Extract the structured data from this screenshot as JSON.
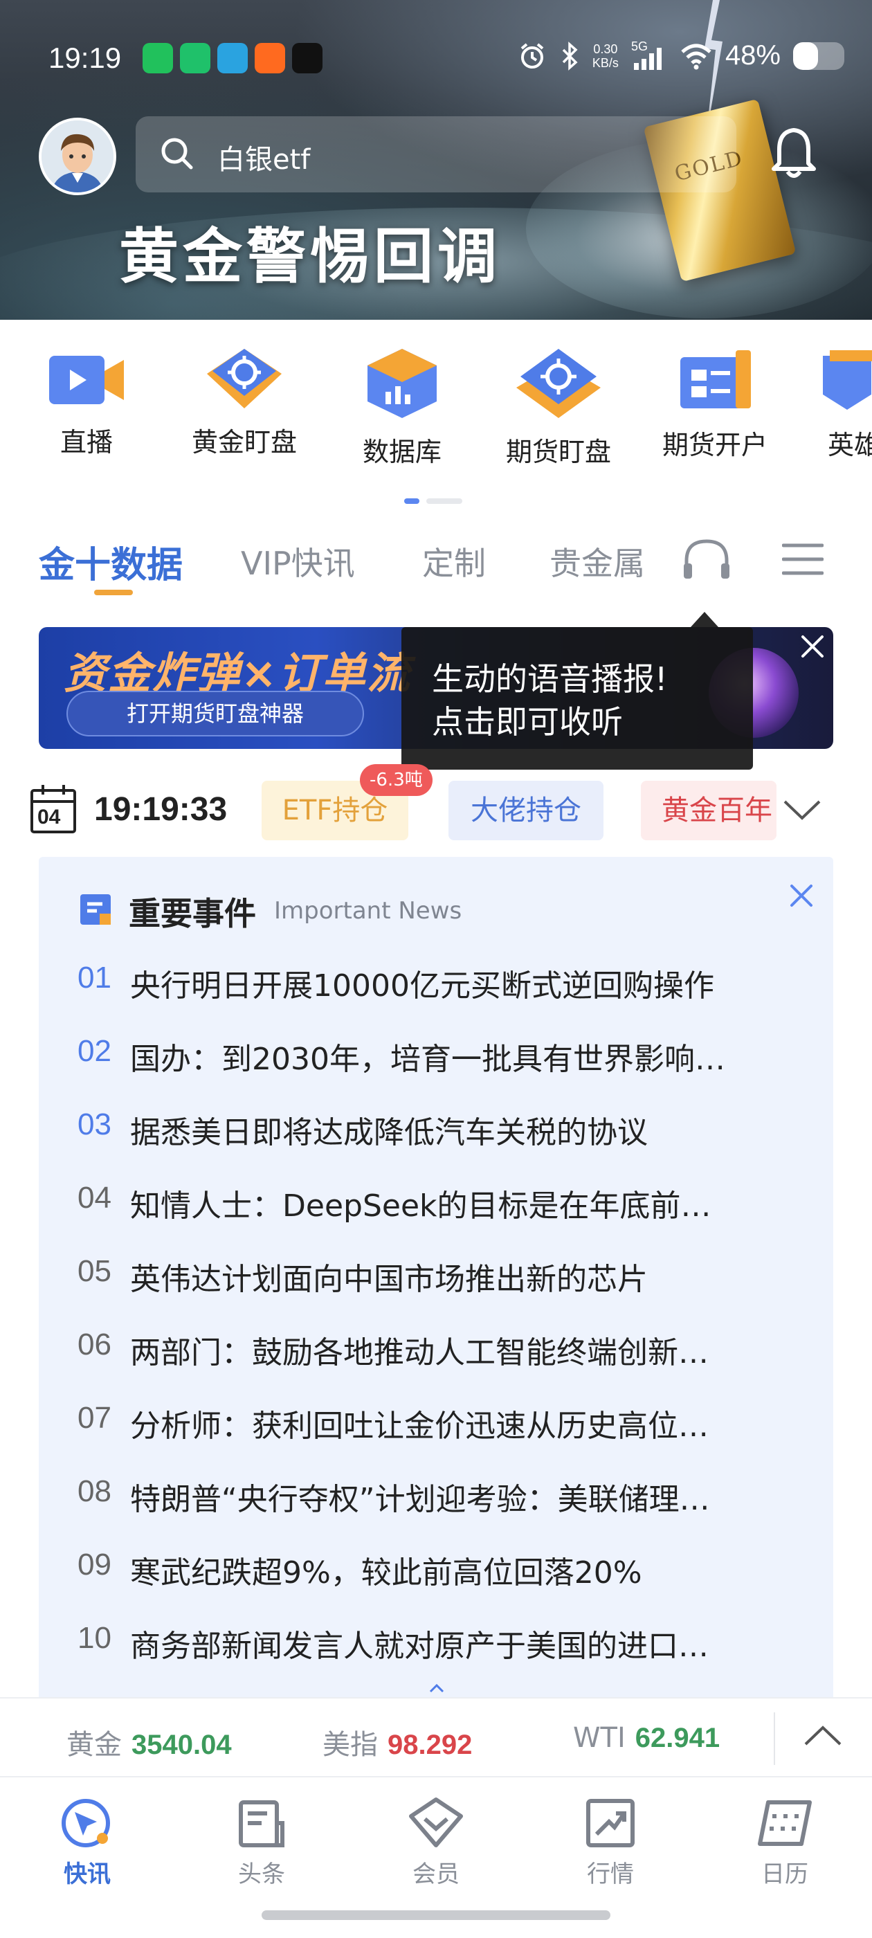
{
  "status_bar": {
    "time": "19:19",
    "net_speed_value": "0.30",
    "net_speed_unit": "KB/s",
    "network": "5G",
    "battery": "48%",
    "battery_level_percent": 48,
    "app_icons": [
      "wechat-icon",
      "mijia-icon",
      "telegram-icon",
      "taobao-icon",
      "moji-weather-icon"
    ]
  },
  "header": {
    "search_placeholder": "白银etf",
    "banner_title": "黄金警惕回调",
    "gold_bar_text": "GOLD"
  },
  "quick_entries": [
    {
      "label": "直播",
      "icon": "live-video-icon"
    },
    {
      "label": "黄金盯盘",
      "icon": "gold-watch-icon"
    },
    {
      "label": "数据库",
      "icon": "database-icon"
    },
    {
      "label": "期货盯盘",
      "icon": "futures-watch-icon"
    },
    {
      "label": "期货开户",
      "icon": "futures-account-icon"
    },
    {
      "label": "英雄",
      "icon": "hero-icon"
    }
  ],
  "tabs": [
    {
      "label": "金十数据",
      "active": true
    },
    {
      "label": "VIP快讯",
      "active": false
    },
    {
      "label": "定制",
      "active": false
    },
    {
      "label": "贵金属",
      "active": false
    }
  ],
  "promo_banner": {
    "headline": "资金炸弹×订单流",
    "button": "打开期货盯盘神器"
  },
  "tooltip": {
    "line1": "生动的语音播报!",
    "line2": "点击即可收听"
  },
  "ticker": {
    "calendar_day": "04",
    "clock": "19:19:33",
    "chips": [
      {
        "label": "ETF持仓",
        "badge": "-6.3吨"
      },
      {
        "label": "大佬持仓"
      },
      {
        "label": "黄金百年"
      }
    ]
  },
  "important_news": {
    "title": "重要事件",
    "subtitle": "Important News",
    "items": [
      {
        "num": "01",
        "text": "央行明日开展10000亿元买断式逆回购操作"
      },
      {
        "num": "02",
        "text": "国办：到2030年，培育一批具有世界影响…"
      },
      {
        "num": "03",
        "text": "据悉美日即将达成降低汽车关税的协议"
      },
      {
        "num": "04",
        "text": "知情人士：DeepSeek的目标是在年底前…"
      },
      {
        "num": "05",
        "text": "英伟达计划面向中国市场推出新的芯片"
      },
      {
        "num": "06",
        "text": "两部门：鼓励各地推动人工智能终端创新…"
      },
      {
        "num": "07",
        "text": "分析师：获利回吐让金价迅速从历史高位…"
      },
      {
        "num": "08",
        "text": "特朗普“央行夺权”计划迎考验：美联储理…"
      },
      {
        "num": "09",
        "text": "寒武纪跌超9%，较此前高位回落20%"
      },
      {
        "num": "10",
        "text": "商务部新闻发言人就对原产于美国的进口…"
      }
    ]
  },
  "market": [
    {
      "name": "黄金",
      "value": "3540.04",
      "color": "#3d9a5c"
    },
    {
      "name": "美指",
      "value": "98.292",
      "color": "#d9454a"
    },
    {
      "name": "WTI",
      "value": "62.941",
      "color": "#3d9a5c"
    }
  ],
  "bottom_nav": [
    {
      "label": "快讯",
      "icon": "flash-news-icon",
      "active": true
    },
    {
      "label": "头条",
      "icon": "headlines-icon",
      "active": false
    },
    {
      "label": "会员",
      "icon": "membership-icon",
      "active": false
    },
    {
      "label": "行情",
      "icon": "quotes-icon",
      "active": false
    },
    {
      "label": "日历",
      "icon": "calendar-icon",
      "active": false
    }
  ],
  "colors": {
    "accent": "#3b6fd6",
    "tab_underline": "#f0a43a",
    "news_bg": "#eef3fd",
    "up_green": "#3d9a5c",
    "down_red": "#d9454a"
  }
}
